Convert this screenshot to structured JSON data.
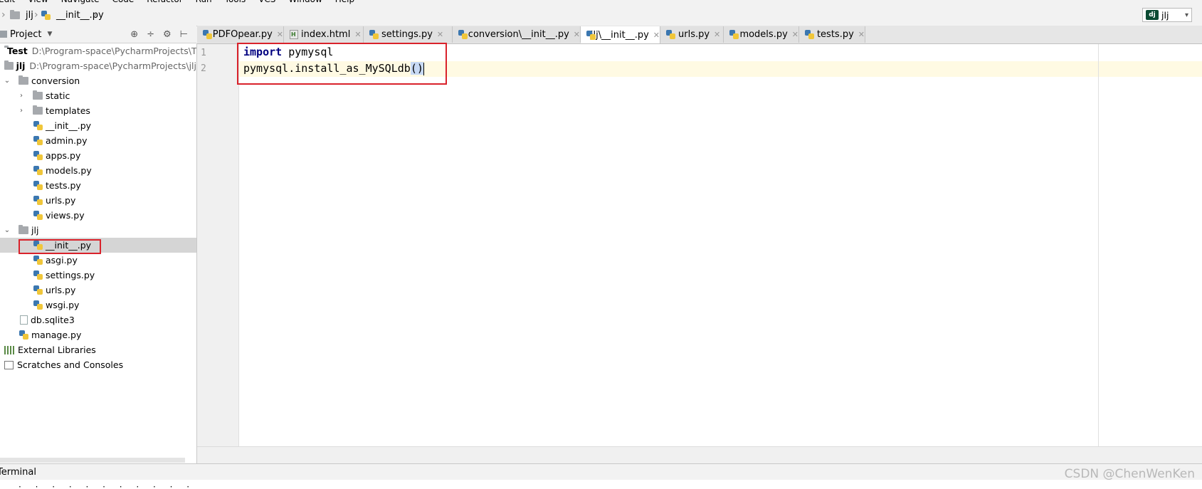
{
  "menubar": {
    "items": [
      "Edit",
      "View",
      "Navigate",
      "Code",
      "Refactor",
      "Run",
      "Tools",
      "VCS",
      "Window",
      "Help"
    ]
  },
  "breadcrumb": {
    "items": [
      "jlj",
      "__init__.py"
    ]
  },
  "run_config": {
    "label": "jlj",
    "icon": "django-icon"
  },
  "project_panel": {
    "title": "Project",
    "icons": [
      "globe-icon",
      "collapse-icon",
      "gear-icon",
      "hide-icon"
    ]
  },
  "tree": [
    {
      "label": "Test",
      "path": "D:\\Program-space\\PycharmProjects\\T",
      "type": "root-folder"
    },
    {
      "label": "jlj",
      "path": "D:\\Program-space\\PycharmProjects\\jlj",
      "type": "root-folder"
    },
    {
      "label": "conversion",
      "type": "folder",
      "expanded": true
    },
    {
      "label": "static",
      "type": "folder"
    },
    {
      "label": "templates",
      "type": "folder"
    },
    {
      "label": "__init__.py",
      "type": "py"
    },
    {
      "label": "admin.py",
      "type": "py"
    },
    {
      "label": "apps.py",
      "type": "py"
    },
    {
      "label": "models.py",
      "type": "py"
    },
    {
      "label": "tests.py",
      "type": "py"
    },
    {
      "label": "urls.py",
      "type": "py"
    },
    {
      "label": "views.py",
      "type": "py"
    },
    {
      "label": "jlj",
      "type": "folder",
      "expanded": true
    },
    {
      "label": "__init__.py",
      "type": "py",
      "selected": true
    },
    {
      "label": "asgi.py",
      "type": "py"
    },
    {
      "label": "settings.py",
      "type": "py"
    },
    {
      "label": "urls.py",
      "type": "py"
    },
    {
      "label": "wsgi.py",
      "type": "py"
    },
    {
      "label": "db.sqlite3",
      "type": "file"
    },
    {
      "label": "manage.py",
      "type": "py"
    },
    {
      "label": "External Libraries",
      "type": "libraries"
    },
    {
      "label": "Scratches and Consoles",
      "type": "scratches"
    }
  ],
  "tabs": [
    {
      "label": "PDFOpear.py"
    },
    {
      "label": "index.html"
    },
    {
      "label": "settings.py"
    },
    {
      "label": "conversion\\__init__.py"
    },
    {
      "label": "jlj\\__init__.py",
      "active": true
    },
    {
      "label": "urls.py"
    },
    {
      "label": "models.py"
    },
    {
      "label": "tests.py"
    }
  ],
  "editor": {
    "line_numbers": [
      "1",
      "2"
    ],
    "line1": {
      "keyword": "import",
      "rest": " pymysql"
    },
    "line2": {
      "text": "pymysql.install_as_MySQLdb",
      "highlighted": "()"
    }
  },
  "bottom": {
    "terminal_label": "Terminal",
    "terminal_text": "· · · · · · · · · · ·"
  },
  "watermark": "CSDN @ChenWenKen",
  "colors": {
    "highlight_box": "#d9222b",
    "keyword": "#000080",
    "current_line": "#fffae3",
    "bracket_match": "#c7d9f4"
  }
}
